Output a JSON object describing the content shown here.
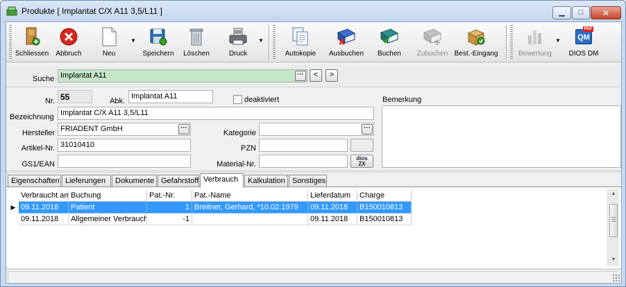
{
  "window": {
    "title": "Produkte [ Implantat C/X A11 3,5/L11 ]",
    "min_glyph": "▁",
    "max_glyph": "□",
    "close_glyph": "✕"
  },
  "toolbar": {
    "schliessen": "Schliessen",
    "abbruch": "Abbruch",
    "neu": "Neu",
    "speichern": "Speichern",
    "loeschen": "Löschen",
    "druck": "Druck",
    "autokopie": "Autokopie",
    "ausbuchen": "Ausbuchen",
    "buchen": "Buchen",
    "zubuchen": "Zubuchen",
    "best_eingang": "Best.-Eingang",
    "bewertung": "Bewertung",
    "dios_dm": "DIOS DM",
    "dropdown_glyph": "▼",
    "dios_icon_text": "QM",
    "dios_icon_badge": "PDF"
  },
  "form": {
    "suche_label": "Suche",
    "suche_value": "Implantat A11",
    "nav_prev": "<",
    "nav_next": ">",
    "dots": "···",
    "nr_label": "Nr.",
    "nr_value": "55",
    "abk_label": "Abk.",
    "abk_value": "Implantat A11",
    "deaktiviert_label": "deaktiviert",
    "bemerkung_label": "Bemerkung",
    "bezeichnung_label": "Bezeichnung",
    "bezeichnung_value": "Implantat C/X A11 3,5/L11",
    "hersteller_label": "Hersteller",
    "hersteller_value": "FRIADENT GmbH",
    "kategorie_label": "Kategorie",
    "kategorie_value": "",
    "artikel_label": "Artikel-Nr.",
    "artikel_value": "31010410",
    "pzn_label": "PZN",
    "pzn_value": "",
    "gs1_label": "GS1/EAN",
    "gs1_value": "",
    "material_label": "Material-Nr.",
    "material_value": "",
    "dios_zx_line1": "dios",
    "dios_zx_line2": "ZX"
  },
  "tabs": [
    {
      "label": "Eigenschaften",
      "active": false
    },
    {
      "label": "Lieferungen",
      "active": false
    },
    {
      "label": "Dokumente",
      "active": false
    },
    {
      "label": "Gefahrstoff",
      "active": false
    },
    {
      "label": "Verbrauch",
      "active": true
    },
    {
      "label": "Kalkulation",
      "active": false
    },
    {
      "label": "Sonstiges",
      "active": false
    }
  ],
  "grid": {
    "columns": [
      "Verbraucht am",
      "Buchung",
      "Pat.-Nr.",
      "Pat.-Name",
      "Lieferdatum",
      "Charge"
    ],
    "row_indicator": "▶",
    "rows": [
      {
        "datum": "09.11.2018",
        "buchung": "Patient",
        "patnr": "1",
        "patname": "Breitner, Gerhard, *10.02.1979",
        "lieferdatum": "09.11.2018",
        "charge": "B150010813",
        "selected": true
      },
      {
        "datum": "09.11.2018",
        "buchung": "Allgemeiner Verbrauch",
        "patnr": "-1",
        "patname": "",
        "lieferdatum": "09.11.2018",
        "charge": "B150010813",
        "selected": false
      }
    ]
  },
  "scrollbar": {
    "up_glyph": "▲",
    "down_glyph": "▼"
  }
}
